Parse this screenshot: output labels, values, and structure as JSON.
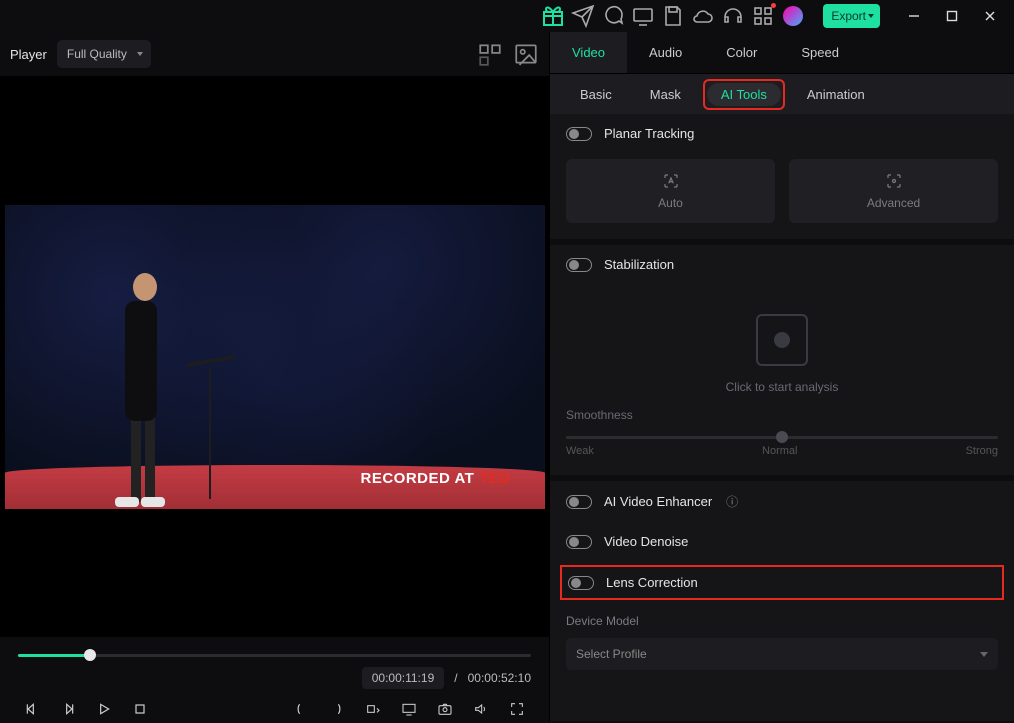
{
  "titlebar": {
    "export_label": "Export"
  },
  "player": {
    "label": "Player",
    "quality": "Full Quality",
    "watermark_prefix": "RECORDED AT ",
    "watermark_brand": "TED",
    "time_current": "00:00:11:19",
    "time_sep": "/",
    "time_total": "00:00:52:10"
  },
  "top_tabs": {
    "video": "Video",
    "audio": "Audio",
    "color": "Color",
    "speed": "Speed"
  },
  "sub_tabs": {
    "basic": "Basic",
    "mask": "Mask",
    "ai_tools": "AI Tools",
    "animation": "Animation"
  },
  "planar": {
    "label": "Planar Tracking",
    "auto": "Auto",
    "advanced": "Advanced"
  },
  "stab": {
    "label": "Stabilization",
    "analysis": "Click to start analysis",
    "smoothness": "Smoothness",
    "weak": "Weak",
    "normal": "Normal",
    "strong": "Strong"
  },
  "toggles": {
    "ai_enhancer": "AI Video Enhancer",
    "denoise": "Video Denoise",
    "lens": "Lens Correction"
  },
  "device": {
    "label": "Device Model",
    "placeholder": "Select Profile"
  }
}
